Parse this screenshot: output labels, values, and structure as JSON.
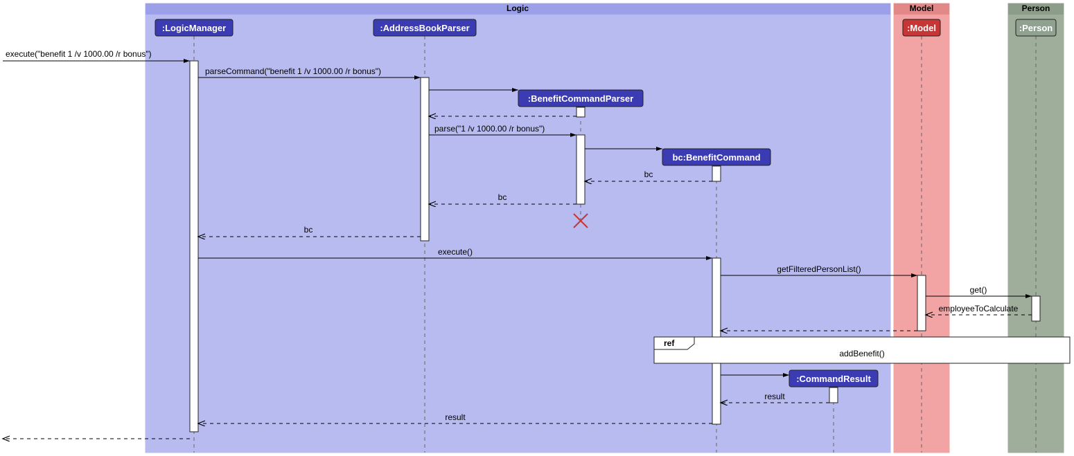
{
  "frames": {
    "logic": "Logic",
    "model": "Model",
    "person": "Person"
  },
  "participants": {
    "logicManager": ":LogicManager",
    "addressBookParser": ":AddressBookParser",
    "benefitCommandParser": ":BenefitCommandParser",
    "benefitCommand": "bc:BenefitCommand",
    "commandResult": ":CommandResult",
    "model": ":Model",
    "person": ":Person"
  },
  "messages": {
    "external_execute": "execute(\"benefit 1 /v 1000.00 /r bonus\")",
    "parseCommand": "parseCommand(\"benefit 1 /v 1000.00 /r bonus\")",
    "parse": "parse(\"1 /v 1000.00 /r bonus\")",
    "bc": "bc",
    "execute": "execute()",
    "getFilteredPersonList": "getFilteredPersonList()",
    "get": "get()",
    "employeeToCalculate": "employeeToCalculate",
    "result": "result",
    "refLabel": "ref",
    "addBenefit": "addBenefit()"
  }
}
